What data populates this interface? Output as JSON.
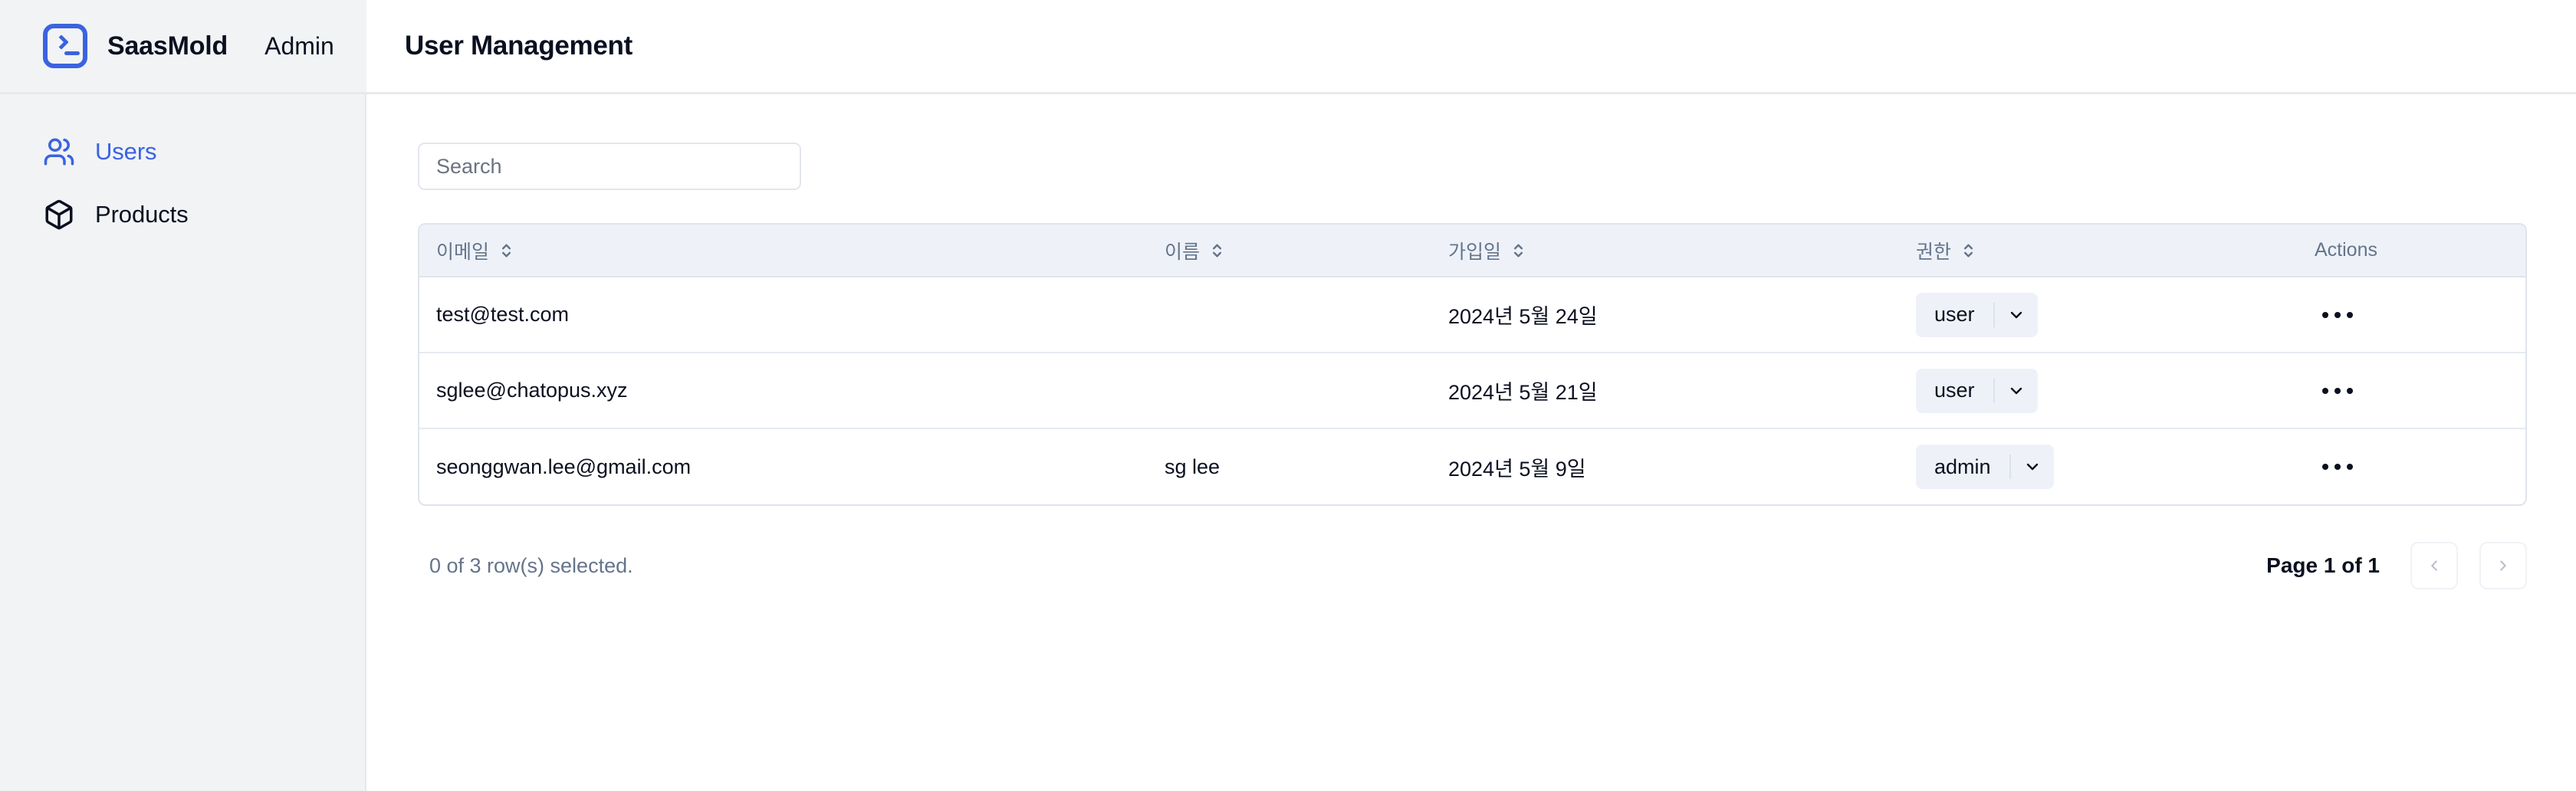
{
  "brand": {
    "logo_icon": "terminal-icon",
    "name": "SaasMold",
    "section": "Admin",
    "accent_color": "#3b63e0"
  },
  "header": {
    "title": "User Management"
  },
  "sidebar": {
    "items": [
      {
        "label": "Users",
        "icon": "users-icon",
        "active": true
      },
      {
        "label": "Products",
        "icon": "box-icon",
        "active": false
      }
    ]
  },
  "search": {
    "placeholder": "Search",
    "value": ""
  },
  "table": {
    "columns": [
      {
        "key": "email",
        "label": "이메일",
        "sortable": true
      },
      {
        "key": "name",
        "label": "이름",
        "sortable": true
      },
      {
        "key": "joined",
        "label": "가입일",
        "sortable": true
      },
      {
        "key": "role",
        "label": "권한",
        "sortable": true
      },
      {
        "key": "actions",
        "label": "Actions",
        "sortable": false
      }
    ],
    "rows": [
      {
        "email": "test@test.com",
        "name": "",
        "joined": "2024년 5월 24일",
        "role": "user",
        "actions_icon": "ellipsis-icon"
      },
      {
        "email": "sglee@chatopus.xyz",
        "name": "",
        "joined": "2024년 5월 21일",
        "role": "user",
        "actions_icon": "ellipsis-icon"
      },
      {
        "email": "seonggwan.lee@gmail.com",
        "name": "sg lee",
        "joined": "2024년 5월 9일",
        "role": "admin",
        "actions_icon": "ellipsis-icon"
      }
    ]
  },
  "footer": {
    "rows_selected": "0 of 3 row(s) selected.",
    "page_indicator": "Page 1 of 1",
    "prev_icon": "chevron-left-icon",
    "next_icon": "chevron-right-icon",
    "prev_disabled": true,
    "next_disabled": true
  }
}
